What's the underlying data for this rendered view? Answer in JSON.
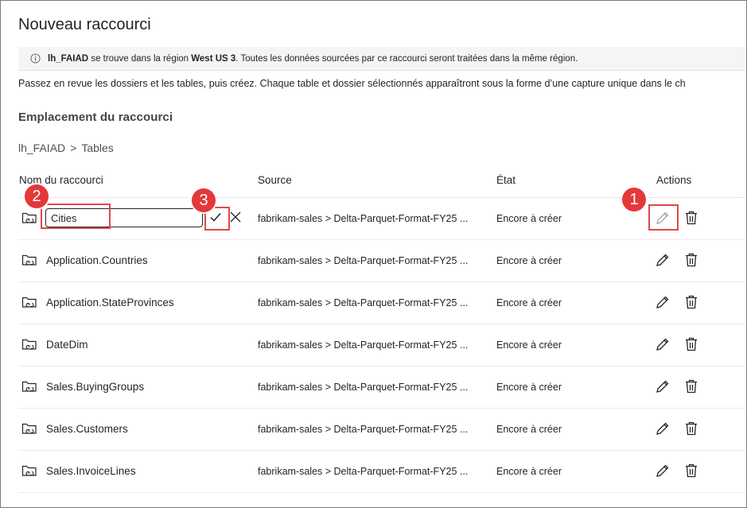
{
  "dialog": {
    "title": "Nouveau raccourci",
    "banner": {
      "lakehouse": "lh_FAIAD",
      "text1": " se trouve dans la région ",
      "region": "West US 3",
      "text2": ". Toutes les données sourcées par ce raccourci seront traitées dans la même région."
    },
    "description": "Passez en revue les dossiers et les tables, puis créez. Chaque table et dossier sélectionnés apparaîtront sous la forme d’une capture unique dans le ch",
    "section_title": "Emplacement du raccourci",
    "breadcrumb": {
      "root": "lh_FAIAD",
      "separator": ">",
      "folder": "Tables"
    }
  },
  "table": {
    "headers": {
      "name": "Nom du raccourci",
      "source": "Source",
      "state": "État",
      "actions": "Actions"
    },
    "editing": {
      "value": "Cities"
    },
    "rows": [
      {
        "name": "Cities",
        "source": "fabrikam-sales > Delta-Parquet-Format-FY25 ...",
        "state": "Encore à créer"
      },
      {
        "name": "Application.Countries",
        "source": "fabrikam-sales > Delta-Parquet-Format-FY25 ...",
        "state": "Encore à créer"
      },
      {
        "name": "Application.StateProvinces",
        "source": "fabrikam-sales > Delta-Parquet-Format-FY25 ...",
        "state": "Encore à créer"
      },
      {
        "name": "DateDim",
        "source": "fabrikam-sales > Delta-Parquet-Format-FY25 ...",
        "state": "Encore à créer"
      },
      {
        "name": "Sales.BuyingGroups",
        "source": "fabrikam-sales > Delta-Parquet-Format-FY25 ...",
        "state": "Encore à créer"
      },
      {
        "name": "Sales.Customers",
        "source": "fabrikam-sales > Delta-Parquet-Format-FY25 ...",
        "state": "Encore à créer"
      },
      {
        "name": "Sales.InvoiceLines",
        "source": "fabrikam-sales > Delta-Parquet-Format-FY25 ...",
        "state": "Encore à créer"
      }
    ]
  },
  "annotations": {
    "badge1": "1",
    "badge2": "2",
    "badge3": "3",
    "color": "#e5383b"
  }
}
